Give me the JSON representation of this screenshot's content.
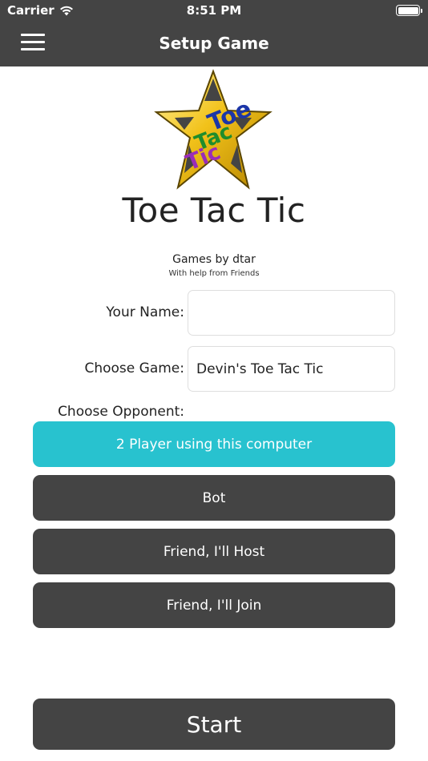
{
  "status_bar": {
    "carrier": "Carrier",
    "time": "8:51 PM"
  },
  "nav": {
    "title": "Setup Game",
    "menu_icon": "hamburger-menu-icon"
  },
  "logo": {
    "word1": "Toe",
    "word2": "Tac",
    "word3": "Tic"
  },
  "app": {
    "title": "Toe Tac Tic",
    "credit": "Games by dtar",
    "credit_sub": "With help from Friends"
  },
  "form": {
    "name_label": "Your Name:",
    "name_value": "",
    "game_label": "Choose Game:",
    "game_value": "Devin's Toe Tac Tic",
    "opponent_label": "Choose Opponent:"
  },
  "opponents": [
    {
      "label": "2 Player using this computer",
      "selected": true
    },
    {
      "label": "Bot",
      "selected": false
    },
    {
      "label": "Friend, I'll Host",
      "selected": false
    },
    {
      "label": "Friend, I'll Join",
      "selected": false
    }
  ],
  "start_label": "Start",
  "colors": {
    "bar": "#444444",
    "selected": "#28c2cf",
    "button": "#444444"
  }
}
